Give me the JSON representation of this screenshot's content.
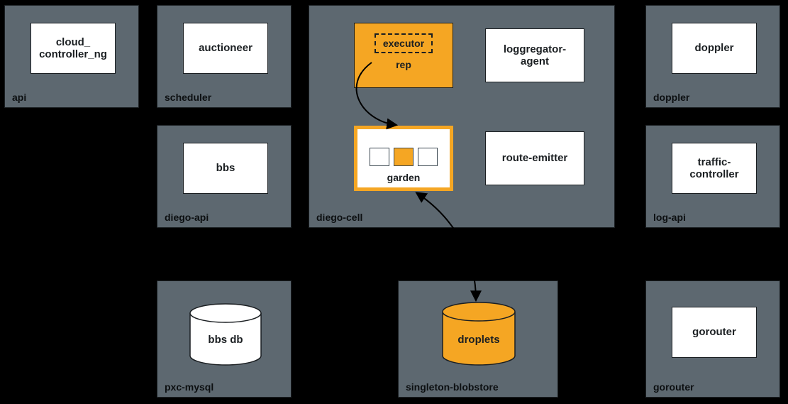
{
  "chart_data": {
    "type": "diagram",
    "title": "",
    "nodes": [
      {
        "id": "api",
        "label": "api",
        "children": [
          {
            "id": "cloud_controller_ng",
            "label": "cloud_\ncontroller_ng",
            "style": "white-box"
          }
        ]
      },
      {
        "id": "scheduler",
        "label": "scheduler",
        "children": [
          {
            "id": "auctioneer",
            "label": "auctioneer",
            "style": "white-box"
          }
        ]
      },
      {
        "id": "diego-api",
        "label": "diego-api",
        "children": [
          {
            "id": "bbs",
            "label": "bbs",
            "style": "white-box"
          }
        ]
      },
      {
        "id": "pxc-mysql",
        "label": "pxc-mysql",
        "children": [
          {
            "id": "bbs-db",
            "label": "bbs db",
            "style": "white-cylinder"
          }
        ]
      },
      {
        "id": "diego-cell",
        "label": "diego-cell",
        "children": [
          {
            "id": "rep",
            "label": "rep",
            "style": "orange-box",
            "children": [
              {
                "id": "executor",
                "label": "executor",
                "style": "dashed-box"
              }
            ]
          },
          {
            "id": "loggregator-agent",
            "label": "loggregator-\nagent",
            "style": "white-box"
          },
          {
            "id": "garden",
            "label": "garden",
            "style": "orange-bordered-box",
            "containers": [
              "empty",
              "running",
              "empty"
            ]
          },
          {
            "id": "route-emitter",
            "label": "route-emitter",
            "style": "white-box"
          }
        ]
      },
      {
        "id": "singleton-blobstore",
        "label": "singleton-blobstore",
        "children": [
          {
            "id": "droplets",
            "label": "droplets",
            "style": "orange-cylinder"
          }
        ]
      },
      {
        "id": "doppler",
        "label": "doppler",
        "children": [
          {
            "id": "doppler-inner",
            "label": "doppler",
            "style": "white-box"
          }
        ]
      },
      {
        "id": "log-api",
        "label": "log-api",
        "children": [
          {
            "id": "traffic-controller",
            "label": "traffic-\ncontroller",
            "style": "white-box"
          }
        ]
      },
      {
        "id": "gorouter",
        "label": "gorouter",
        "children": [
          {
            "id": "gorouter-inner",
            "label": "gorouter",
            "style": "white-box"
          }
        ]
      }
    ],
    "edges": [
      {
        "from": "executor",
        "to": "garden",
        "style": "arrow"
      },
      {
        "from": "droplets",
        "to": "garden",
        "style": "bidirectional-arrow"
      }
    ]
  },
  "labels": {
    "api": "api",
    "cloud_controller_ng": "cloud_\ncontroller_ng",
    "scheduler": "scheduler",
    "auctioneer": "auctioneer",
    "diego_api": "diego-api",
    "bbs": "bbs",
    "pxc_mysql": "pxc-mysql",
    "bbs_db": "bbs db",
    "diego_cell": "diego-cell",
    "executor": "executor",
    "rep": "rep",
    "loggregator_agent": "loggregator-\nagent",
    "garden": "garden",
    "route_emitter": "route-emitter",
    "singleton_blobstore": "singleton-blobstore",
    "droplets": "droplets",
    "doppler_container": "doppler",
    "doppler": "doppler",
    "log_api": "log-api",
    "traffic_controller": "traffic-\ncontroller",
    "gorouter_container": "gorouter",
    "gorouter": "gorouter"
  },
  "colors": {
    "container_bg": "#5d6870",
    "highlight": "#f5a623",
    "box_bg": "#ffffff",
    "stroke": "#1b1f22"
  }
}
